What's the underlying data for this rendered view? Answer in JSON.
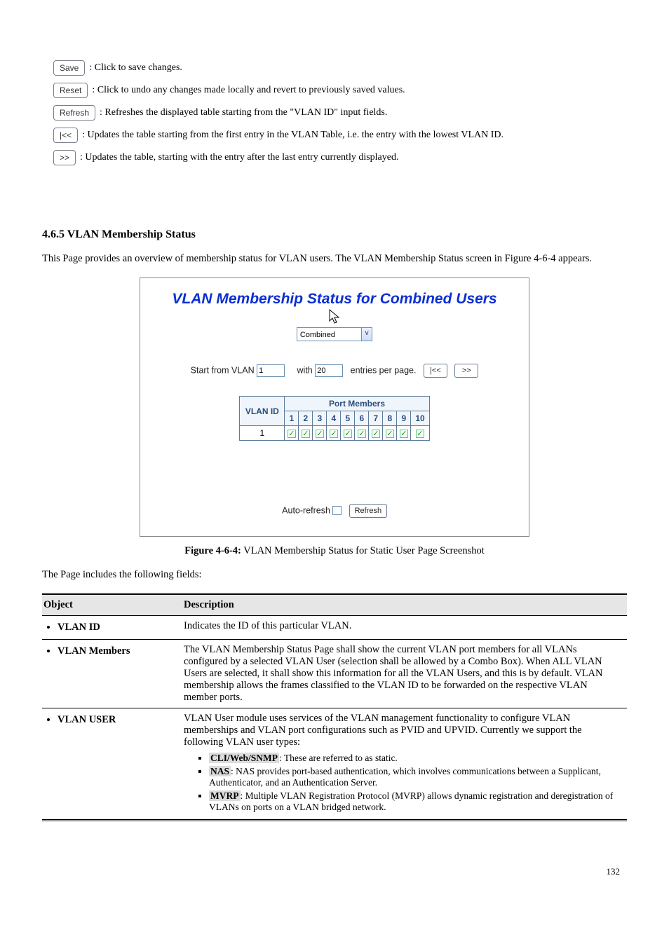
{
  "buttons_sidebar": {
    "items": [
      {
        "img": "Save",
        "desc": ": Click to save changes."
      },
      {
        "img": "Reset",
        "desc": ": Click to undo any changes made locally and revert to previously saved values."
      },
      {
        "img": "Refresh",
        "desc": ": Refreshes the displayed table starting from the \"VLAN ID\" input fields."
      },
      {
        "img": "|<<",
        "desc": ": Updates the table starting from the first entry in the VLAN Table, i.e. the entry with the lowest VLAN ID."
      },
      {
        "img": ">>",
        "desc": ": Updates the table, starting with the entry after the last entry currently displayed."
      }
    ]
  },
  "section": {
    "title": "4.6.5 VLAN Membership Status",
    "intro": "This Page provides an overview of membership status for VLAN users. The VLAN Membership Status screen in Figure 4-6-4 appears.",
    "fig_label": "Figure 4-6-4:",
    "fig_text": " VLAN Membership Status for Static User Page Screenshot"
  },
  "shot": {
    "title": "VLAN Membership Status for Combined Users",
    "combo_value": "Combined",
    "row2": {
      "label_start": "Start from VLAN",
      "in_start": "1",
      "label_with": "with",
      "in_with": "20",
      "label_entries": "entries per page.",
      "btn_first": "|<<",
      "btn_next": ">>"
    },
    "pm": {
      "header_main": "Port Members",
      "vlan_id_hdr": "VLAN ID",
      "cols": [
        "1",
        "2",
        "3",
        "4",
        "5",
        "6",
        "7",
        "8",
        "9",
        "10"
      ],
      "row_id": "1"
    },
    "row3": {
      "auto": "Auto-refresh",
      "refresh": "Refresh"
    }
  },
  "objects": {
    "intro": "The Page includes the following fields:",
    "hdr1": "Object",
    "hdr2": "Description",
    "rows": [
      {
        "obj": "VLAN ID",
        "desc": "Indicates the ID of this particular VLAN."
      },
      {
        "obj": "VLAN Members",
        "desc": "The VLAN Membership Status Page shall show the current VLAN port members for all VLANs configured by a selected VLAN User (selection shall be allowed by a Combo Box). When ALL VLAN Users are selected, it shall show this information for all the VLAN Users, and this is by default. VLAN membership allows the frames classified to the VLAN ID to be forwarded on the respective VLAN member ports."
      }
    ],
    "vlan_user": {
      "obj": "VLAN USER",
      "intro": "VLAN User module uses services of the VLAN management functionality to configure VLAN memberships and VLAN port configurations such as PVID and UPVID. Currently we support the following VLAN user types:",
      "items": [
        {
          "label": "CLI/Web/SNMP",
          "desc": ": These are referred to as static."
        },
        {
          "label": "NAS",
          "desc": ": NAS provides port-based authentication, which involves communications between a Supplicant, Authenticator, and an Authentication Server."
        },
        {
          "label": "MVRP",
          "desc": ": Multiple VLAN Registration Protocol (MVRP) allows dynamic registration and deregistration of VLANs on ports on a VLAN bridged network."
        }
      ]
    }
  },
  "page_number": "132"
}
